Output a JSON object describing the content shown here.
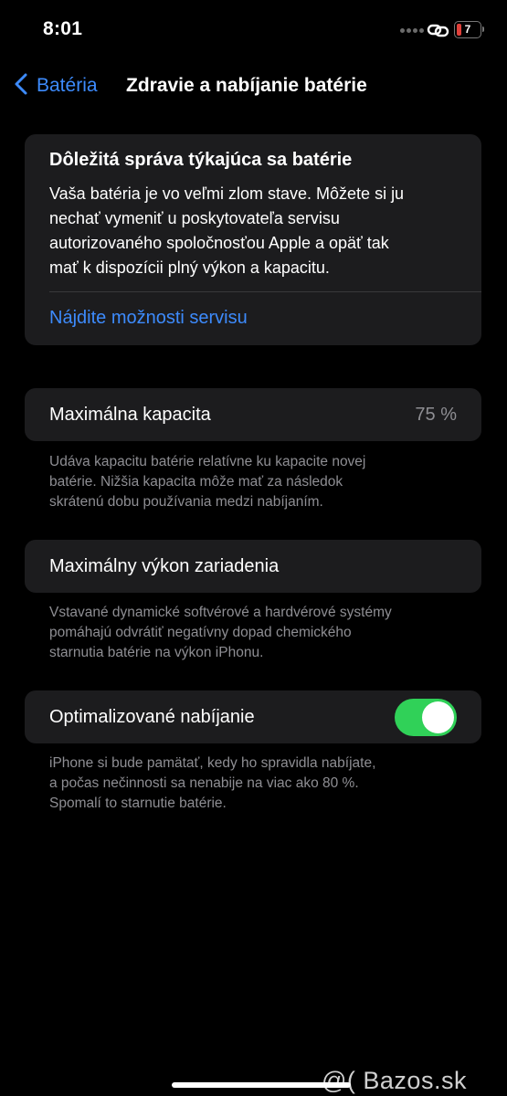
{
  "status_bar": {
    "time": "8:01",
    "battery_level": "7",
    "battery_color": "#e0403a",
    "icons": [
      "signal-dots-icon",
      "link-icon",
      "battery-icon"
    ]
  },
  "nav": {
    "back_label": "Batéria",
    "title": "Zdravie a nabíjanie batérie"
  },
  "alert": {
    "title": "Dôležitá správa týkajúca sa batérie",
    "lines": [
      "Vaša batéria je vo veľmi zlom stave. Môžete si ju",
      "nechať vymeniť u poskytovateľa servisu",
      "autorizovaného spoločnosťou Apple a opäť tak",
      "mať k dispozícii plný výkon a kapacitu."
    ],
    "link": "Nájdite možnosti servisu"
  },
  "max_capacity": {
    "label": "Maximálna kapacita",
    "value": "75 %",
    "footnote_lines": [
      "Udáva kapacitu batérie relatívne ku kapacite novej",
      "batérie. Nižšia kapacita môže mať za následok",
      "skrátenú dobu používania medzi nabíjaním."
    ]
  },
  "peak_performance": {
    "label": "Maximálny výkon zariadenia",
    "footnote_lines": [
      "Vstavané dynamické softvérové a hardvérové systémy",
      "pomáhajú odvrátiť negatívny dopad chemického",
      "starnutia batérie na výkon iPhonu."
    ]
  },
  "optimized_charging": {
    "label": "Optimalizované nabíjanie",
    "enabled": true,
    "toggle_color": "#30d158",
    "footnote_lines": [
      "iPhone si bude pamätať, kedy ho spravidla nabíjate,",
      "a počas nečinnosti sa nenabije na viac ako 80 %.",
      "Spomalí to starnutie batérie."
    ]
  },
  "colors": {
    "background": "#000000",
    "card": "#1c1c1e",
    "accent": "#3d8bfd",
    "secondary_text": "#8e8e93"
  },
  "watermark": "@( Bazos.sk"
}
